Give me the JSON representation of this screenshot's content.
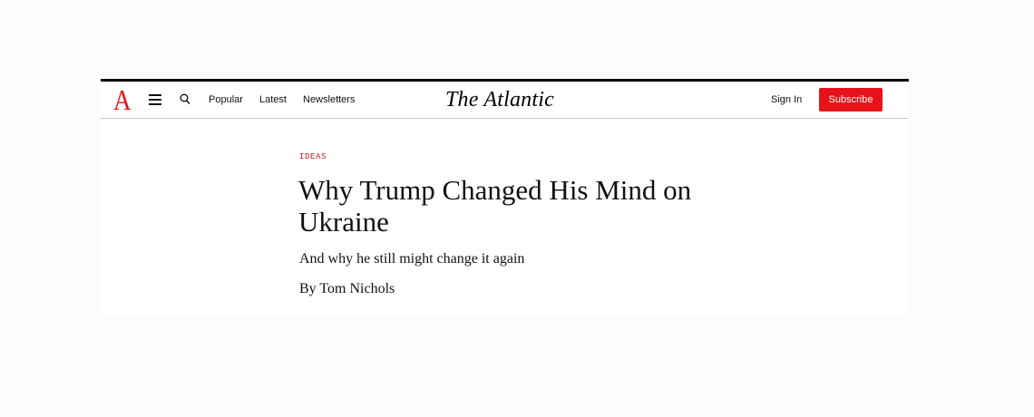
{
  "nav": {
    "logo_letter": "A",
    "links": [
      "Popular",
      "Latest",
      "Newsletters"
    ],
    "masthead": "The Atlantic",
    "sign_in": "Sign In",
    "subscribe": "Subscribe",
    "icons": [
      "hamburger-menu-icon",
      "search-icon"
    ]
  },
  "article": {
    "section": "IDEAS",
    "headline": "Why Trump Changed His Mind on Ukraine",
    "dek": "And why he still might change it again",
    "byline": "By Tom Nichols"
  },
  "colors": {
    "brand_red": "#e7131a",
    "section_red": "#c4161c",
    "text": "#111111"
  }
}
